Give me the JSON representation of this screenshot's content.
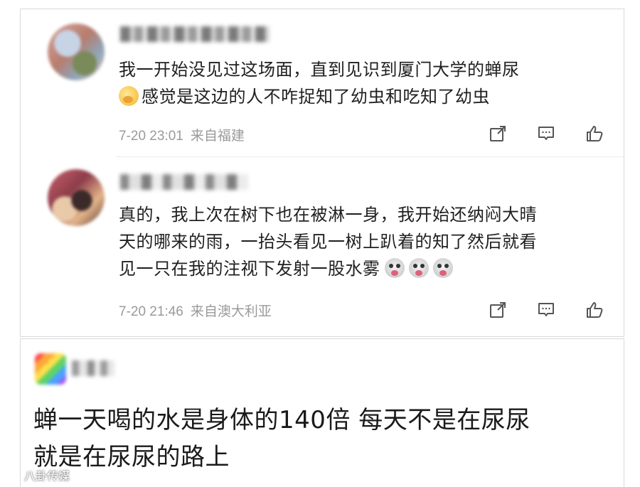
{
  "comments": [
    {
      "text_line1": "我一开始没见过这场面，直到见识到厦门大学的蝉尿",
      "emoji": "yawn-emoji",
      "text_line2": "感觉是这边的人不咋捉知了幼虫和吃知了幼虫",
      "time": "7-20 23:01",
      "source": "来自福建"
    },
    {
      "text_line1": "真的，我上次在树下也在被淋一身，我开始还纳闷大晴",
      "text_line2": "天的哪来的雨，一抬头看见一树上趴着的知了然后就看",
      "text_line3": "见一只在我的注视下发射一股水雾",
      "emoji": "shocked-face-emoji",
      "emoji_count": 3,
      "time": "7-20 21:46",
      "source": "来自澳大利亚"
    }
  ],
  "actions": [
    "share-icon",
    "comment-icon",
    "like-icon"
  ],
  "post": {
    "line1": "蝉一天喝的水是身体的140倍 每天不是在尿尿",
    "line2": "就是在尿尿的路上"
  },
  "watermark": {
    "text": "八卦传媒",
    "logo": "watermark-logo-icon"
  },
  "colors": {
    "meta_text": "#9a9a9a",
    "border": "#d9d9d9"
  }
}
